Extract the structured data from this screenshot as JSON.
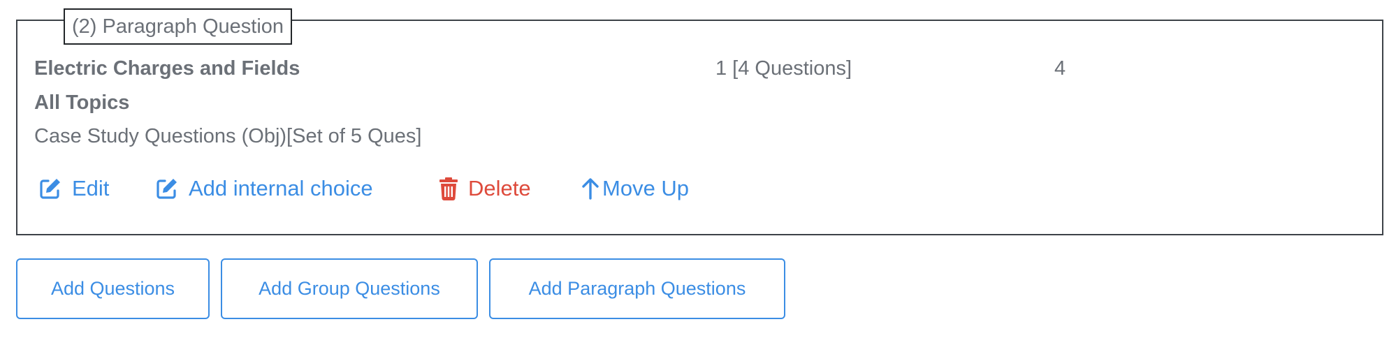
{
  "section": {
    "legend": "(2) Paragraph Question",
    "chapter": "Electric Charges and Fields",
    "count_text": "1 [4 Questions]",
    "marks": "4",
    "topics": "All Topics",
    "question_type": "Case Study Questions (Obj)[Set of 5 Ques]"
  },
  "actions": {
    "edit_label": "Edit",
    "add_internal_choice_label": "Add internal choice",
    "delete_label": "Delete",
    "move_up_label": "Move Up"
  },
  "icons": {
    "edit": "edit-icon",
    "add_internal_choice": "edit-icon",
    "delete": "trash-icon",
    "move_up": "arrow-up-icon"
  },
  "buttons": {
    "add_questions": "Add Questions",
    "add_group_questions": "Add Group Questions",
    "add_paragraph_questions": "Add Paragraph Questions"
  },
  "colors": {
    "link_blue": "#3b8de4",
    "delete_red": "#de4a3b",
    "text_gray": "#6b7077",
    "border_dark": "#3d4248"
  }
}
